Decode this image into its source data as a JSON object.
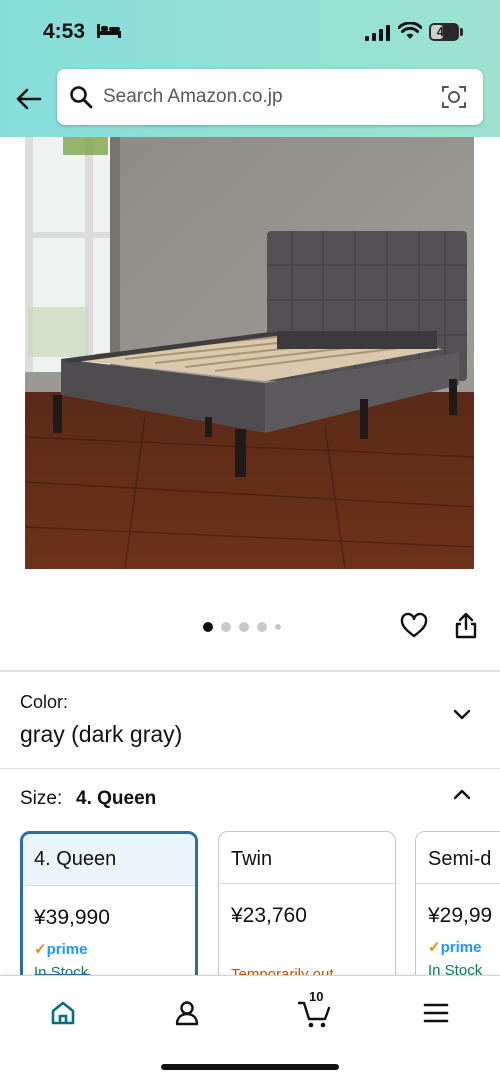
{
  "status_bar": {
    "time": "4:53",
    "battery": "47"
  },
  "header": {
    "search": {
      "placeholder": "Search Amazon.co.jp"
    }
  },
  "product": {
    "image_alt": "Upholstered platform bed with gray tufted headboard",
    "gallery_dots": 5,
    "gallery_active_index": 0
  },
  "variations": {
    "color": {
      "label": "Color:",
      "value": "gray (dark gray)"
    },
    "size": {
      "label": "Size:",
      "value": "4. Queen",
      "options": [
        {
          "name": "4. Queen",
          "price": "¥39,990",
          "prime_check": "✓",
          "prime": "prime",
          "stock": "In Stock",
          "stock_status": "in"
        },
        {
          "name": "Twin",
          "price": "¥23,760",
          "prime_check": "",
          "prime": "",
          "stock": "Temporarily out",
          "stock_status": "out"
        },
        {
          "name": "Semi-d",
          "price": "¥29,99",
          "prime_check": "✓",
          "prime": "prime",
          "stock": "In Stock",
          "stock_status": "in"
        }
      ]
    }
  },
  "bottom_nav": {
    "cart_count": "10",
    "items": [
      "home-icon",
      "account-icon",
      "cart-icon",
      "menu-icon"
    ]
  },
  "colors": {
    "header_start": "#86dedb",
    "header_end": "#9ee2cf",
    "selected_border": "#2f6da3",
    "prime_blue": "#1a98ff",
    "in_stock": "#067d62",
    "out_of_stock": "#c45500",
    "home_active": "#007185"
  }
}
